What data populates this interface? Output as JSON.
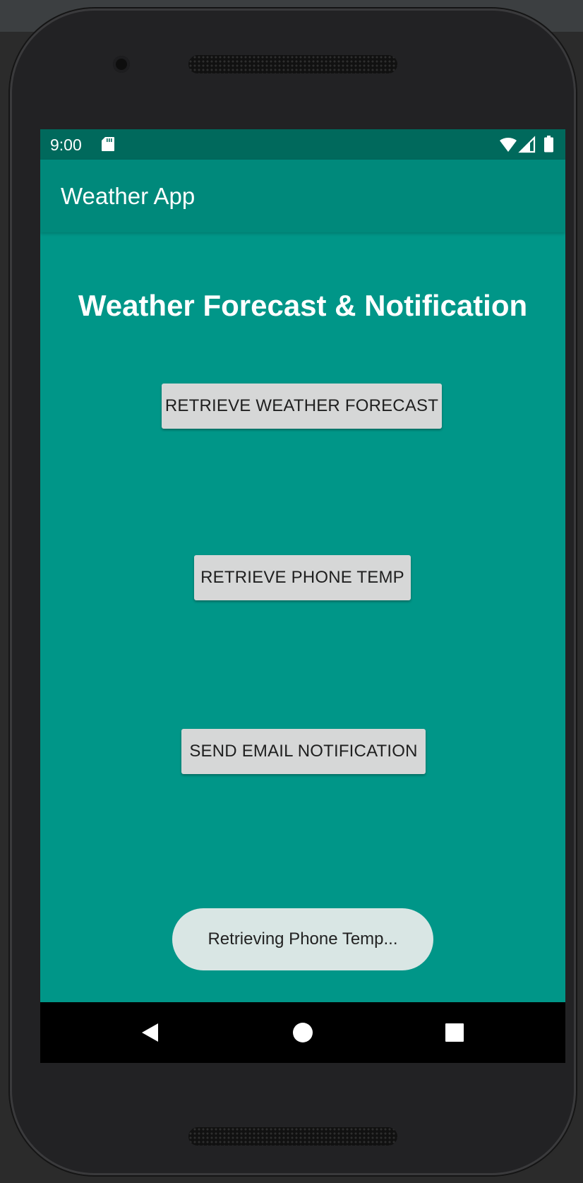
{
  "status_bar": {
    "time": "9:00",
    "icons": [
      "sd-card-icon",
      "wifi-icon",
      "cell-signal-icon",
      "battery-icon"
    ]
  },
  "app_bar": {
    "title": "Weather App"
  },
  "main": {
    "heading": "Weather Forecast & Notification",
    "buttons": {
      "forecast": "RETRIEVE WEATHER FORECAST",
      "phone_temp": "RETRIEVE PHONE TEMP",
      "email": "SEND EMAIL NOTIFICATION"
    }
  },
  "toast": {
    "message": "Retrieving Phone Temp..."
  },
  "navigation": {
    "icons": [
      "back-icon",
      "home-icon",
      "recents-icon"
    ]
  },
  "colors": {
    "primary": "#009688",
    "app_bar": "#00897b",
    "status_bar": "#00695c",
    "button": "#d6d7d7",
    "toast": "#d9e6e4"
  }
}
